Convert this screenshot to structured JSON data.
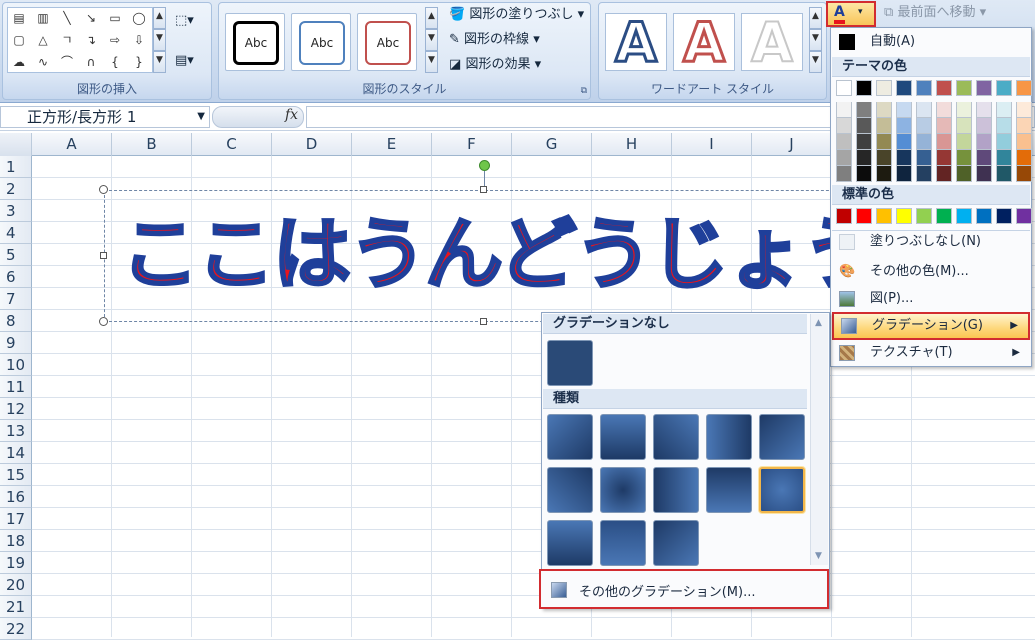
{
  "ribbon": {
    "groups": {
      "insert_shapes": "図形の挿入",
      "shape_styles": "図形のスタイル",
      "wordart_styles": "ワードアート スタイル"
    },
    "style_boxes": [
      "Abc",
      "Abc",
      "Abc"
    ],
    "commands": {
      "fill": "図形の塗りつぶし",
      "outline": "図形の枠線",
      "effects": "図形の効果",
      "bring_front": "最前面へ移動"
    },
    "wordart_letters": [
      "A",
      "A",
      "A"
    ]
  },
  "formula_bar": {
    "name_box": "正方形/長方形 1",
    "fx": "fx"
  },
  "sheet": {
    "columns": [
      "A",
      "B",
      "C",
      "D",
      "E",
      "F",
      "G",
      "H",
      "I",
      "J"
    ],
    "rows": [
      "1",
      "2",
      "3",
      "4",
      "5",
      "6",
      "7",
      "8",
      "9",
      "10",
      "11",
      "12",
      "13",
      "14",
      "15",
      "16",
      "17",
      "18",
      "19",
      "20",
      "21",
      "22"
    ],
    "shape_text": "ここはうんどうじょう"
  },
  "color_menu": {
    "auto": "自動(A)",
    "theme_header": "テーマの色",
    "standard_header": "標準の色",
    "no_fill": "塗りつぶしなし(N)",
    "more_colors": "その他の色(M)...",
    "picture": "図(P)...",
    "gradient": "グラデーション(G)",
    "texture": "テクスチャ(T)",
    "theme_top": [
      "#ffffff",
      "#000000",
      "#eeece1",
      "#1f497d",
      "#4f81bd",
      "#c0504d",
      "#9bbb59",
      "#8064a2",
      "#4bacc6",
      "#f79646"
    ],
    "theme_shades": [
      [
        "#f2f2f2",
        "#7f7f7f",
        "#ddd9c3",
        "#c6d9f0",
        "#dbe5f1",
        "#f2dcdb",
        "#ebf1dd",
        "#e5e0ec",
        "#dbeef3",
        "#fdeada"
      ],
      [
        "#d8d8d8",
        "#595959",
        "#c4bd97",
        "#8db3e2",
        "#b8cce4",
        "#e5b9b7",
        "#d7e3bc",
        "#ccc1d9",
        "#b7dde8",
        "#fbd5b5"
      ],
      [
        "#bfbfbf",
        "#3f3f3f",
        "#938953",
        "#548dd4",
        "#95b3d7",
        "#d99694",
        "#c3d69b",
        "#b2a2c7",
        "#92cddc",
        "#fac08f"
      ],
      [
        "#a5a5a5",
        "#262626",
        "#494429",
        "#17365d",
        "#366092",
        "#953734",
        "#76923c",
        "#5f497a",
        "#31859b",
        "#e36c09"
      ],
      [
        "#7f7f7f",
        "#0c0c0c",
        "#1d1b10",
        "#0f243e",
        "#244061",
        "#632423",
        "#4f6128",
        "#3f3151",
        "#205867",
        "#974806"
      ]
    ],
    "standard": [
      "#c00000",
      "#ff0000",
      "#ffc000",
      "#ffff00",
      "#92d050",
      "#00b050",
      "#00b0f0",
      "#0070c0",
      "#002060",
      "#7030a0"
    ]
  },
  "gradient_panel": {
    "none_header": "グラデーションなし",
    "types_header": "種類",
    "more_gradients": "その他のグラデーション(M)..."
  },
  "colors": {
    "accent_red": "#d22c30",
    "wordart_fill": "#e8141c",
    "wordart_outline": "#1f3f9a"
  }
}
